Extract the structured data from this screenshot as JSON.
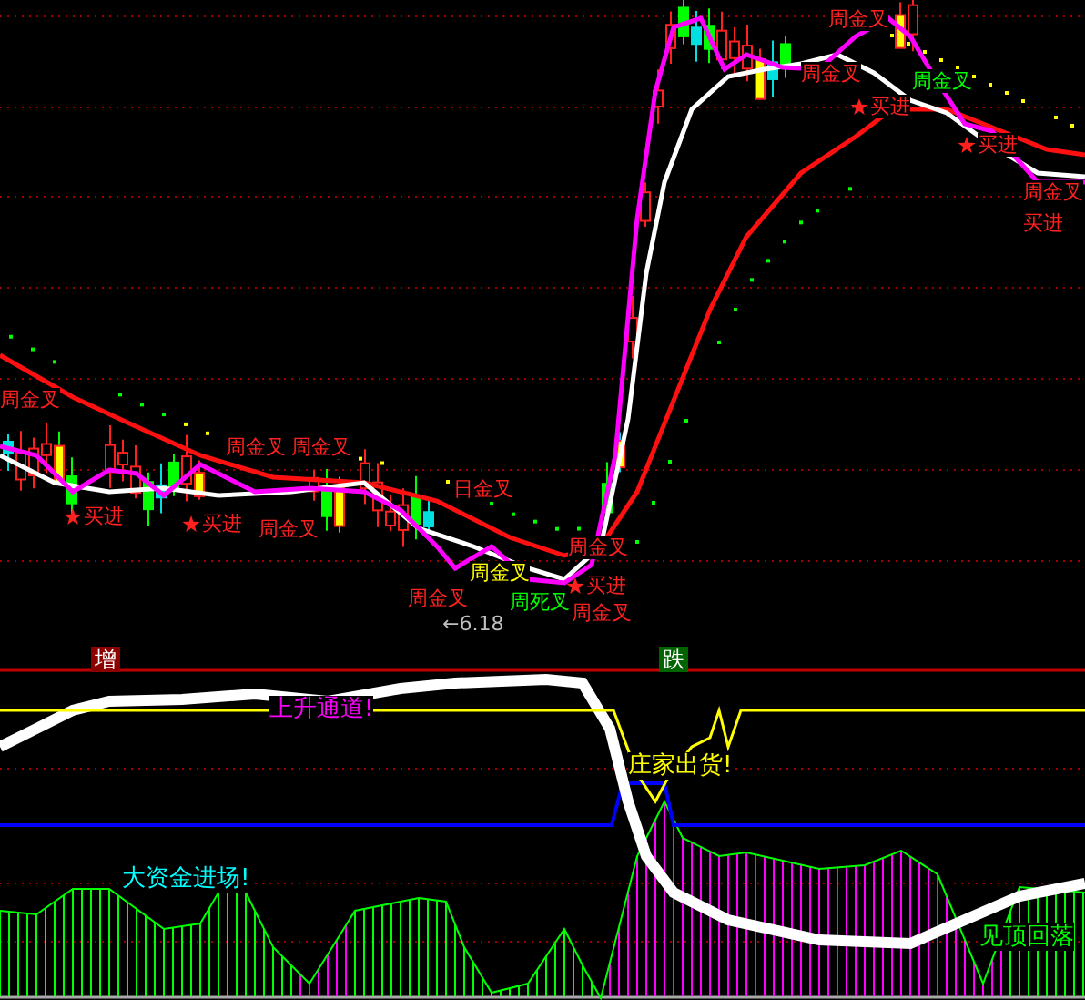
{
  "annotations": [
    {
      "text": "周金叉",
      "color": "#ff2020"
    },
    {
      "text": "买进",
      "color": "#ff2020"
    },
    {
      "text": "周金叉",
      "color": "#ff2020"
    },
    {
      "text": "周金叉",
      "color": "#ff2020"
    },
    {
      "text": "买进",
      "color": "#ff2020"
    },
    {
      "text": "周金叉",
      "color": "#ff2020"
    },
    {
      "text": "日金叉",
      "color": "#ff2020"
    },
    {
      "text": "周金叉",
      "color": "#ffff00"
    },
    {
      "text": "周金叉",
      "color": "#ff2020"
    },
    {
      "text": "周死叉",
      "color": "#00ff00"
    },
    {
      "text": "买进",
      "color": "#ff2020"
    },
    {
      "text": "周金叉",
      "color": "#ff2020"
    },
    {
      "text": "←6.18",
      "color": "#c0c0c0"
    },
    {
      "text": "周金叉",
      "color": "#ff2020"
    },
    {
      "text": "周金叉",
      "color": "#ff2020"
    },
    {
      "text": "周金叉",
      "color": "#ff2020"
    },
    {
      "text": "买进",
      "color": "#ff2020"
    },
    {
      "text": "周金叉",
      "color": "#00ff00"
    },
    {
      "text": "买进",
      "color": "#ff2020"
    },
    {
      "text": "周金叉",
      "color": "#ff2020"
    },
    {
      "text": "买进",
      "color": "#ff2020"
    }
  ],
  "markers": [
    {
      "text": "增",
      "kind": "rise"
    },
    {
      "text": "跌",
      "kind": "fall"
    }
  ],
  "signals": [
    {
      "text": "上升通道!",
      "color": "#ff00ff"
    },
    {
      "text": "庄家出货!",
      "color": "#ffff00"
    },
    {
      "text": "大资金进场!",
      "color": "#00ffff"
    },
    {
      "text": "见顶回落",
      "color": "#00ff00"
    }
  ]
}
